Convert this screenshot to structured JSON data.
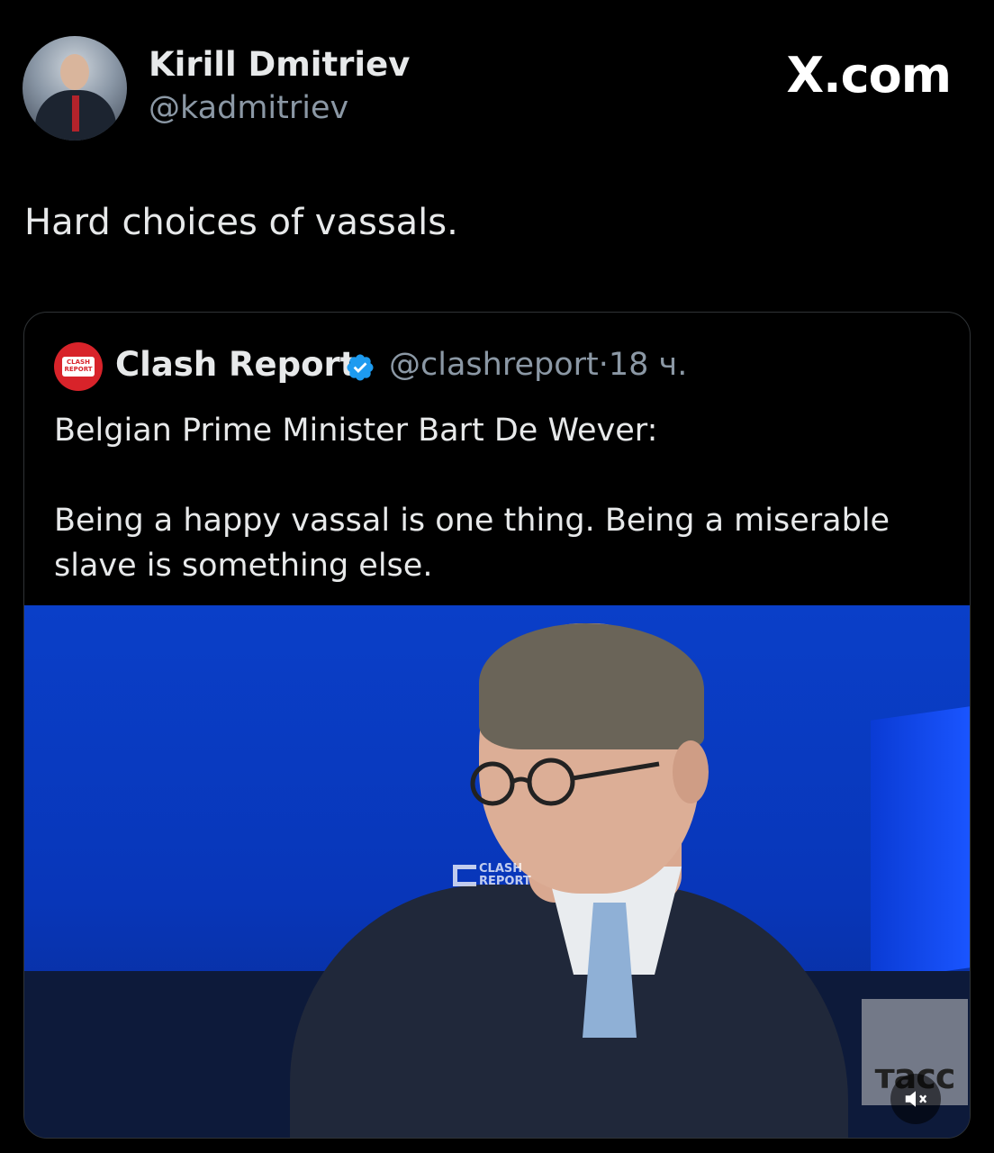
{
  "post": {
    "author_name": "Kirill Dmitriev",
    "author_handle": "@kadmitriev",
    "site_label": "X.com",
    "text": "Hard choices of vassals."
  },
  "quoted": {
    "author_name": "Clash Report",
    "author_handle": "@clashreport",
    "separator": "·",
    "time": "18 ч.",
    "avatar_text": "CLASH REPORT",
    "text_line1": "Belgian Prime Minister Bart De Wever:",
    "text_line2": "Being a happy vassal is one thing. Being a miserable slave is something else.",
    "video": {
      "watermark_line1": "CLASH",
      "watermark_line2": "REPORT",
      "corner_logo": "тасс",
      "mute_icon": "muted-speaker-icon"
    }
  },
  "icons": {
    "verified": "verified-badge-icon",
    "site_logo": "x-logo-icon"
  },
  "colors": {
    "background": "#000000",
    "text": "#e7e9ea",
    "secondary_text": "#8b98a5",
    "verified_blue": "#1d9bf0",
    "video_blue": "#0a3fc8",
    "brand_red": "#d8232a"
  }
}
